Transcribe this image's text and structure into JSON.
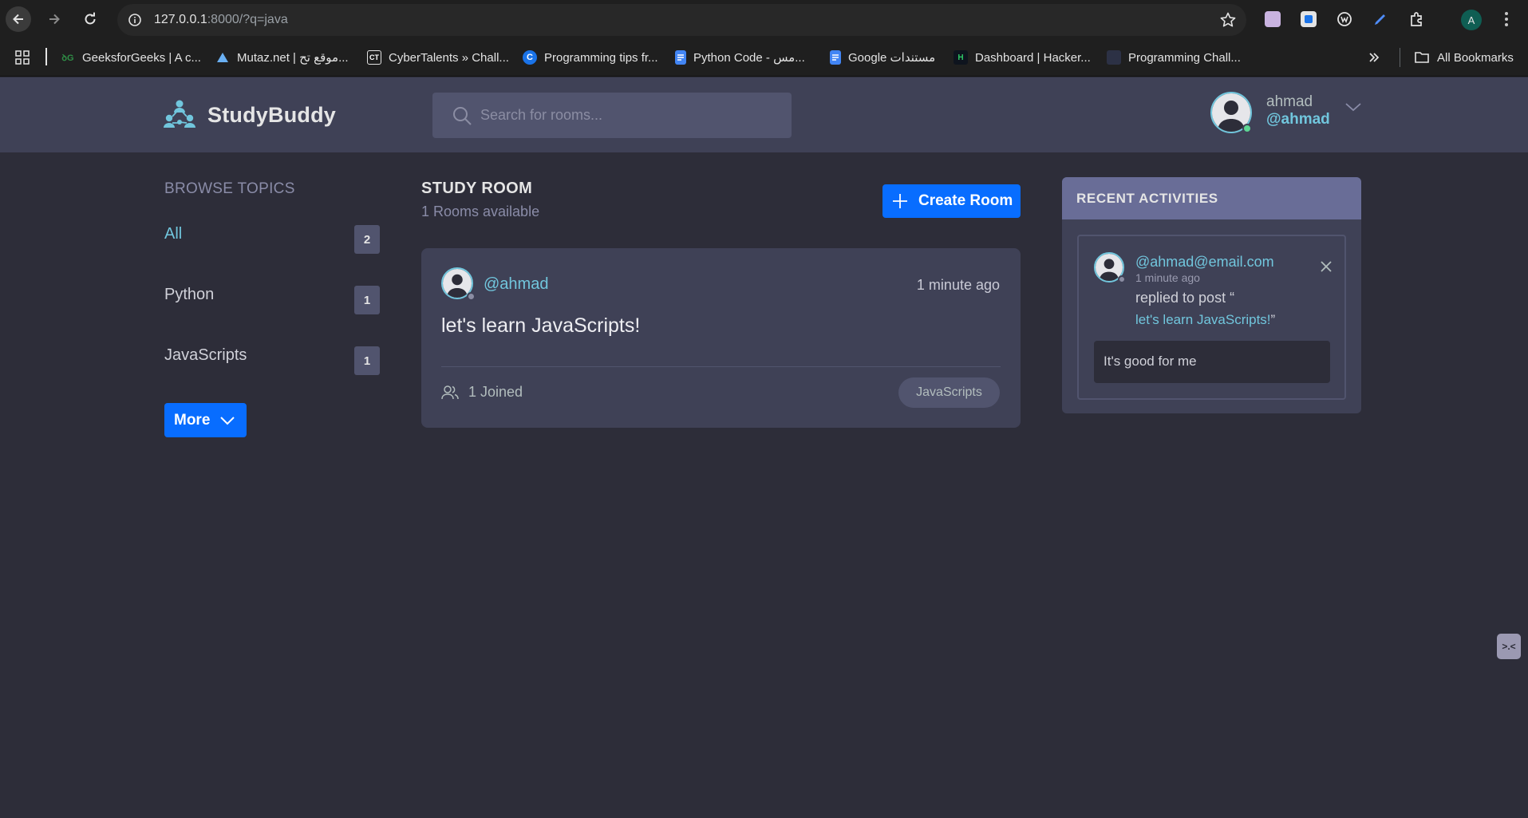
{
  "browser": {
    "url_host": "127.0.0.1",
    "url_path": ":8000/?q=java",
    "bookmarks": [
      {
        "label": "GeeksforGeeks | A c...",
        "icon": "geeksforgeeks-icon",
        "color": "#2f8d46"
      },
      {
        "label": "Mutaz.net | موقع تح...",
        "icon": "mutaz-icon",
        "color": "#4a90d9"
      },
      {
        "label": "CyberTalents » Chall...",
        "icon": "cybertalents-icon",
        "color": "#1e3a8a"
      },
      {
        "label": "Programming tips fr...",
        "icon": "c-logo-icon",
        "color": "#1a73e8"
      },
      {
        "label": "Python Code - مس...",
        "icon": "docs-icon",
        "color": "#4285f4"
      },
      {
        "label": "Google مستندات",
        "icon": "docs-icon",
        "color": "#4285f4"
      },
      {
        "label": "Dashboard | Hacker...",
        "icon": "hackerrank-icon",
        "color": "#0e141e"
      },
      {
        "label": "Programming Chall...",
        "icon": "blank-page-icon",
        "color": "#2c3145"
      }
    ],
    "all_bookmarks_label": "All Bookmarks",
    "profile_initial": "A"
  },
  "header": {
    "brand": "StudyBuddy",
    "search_placeholder": "Search for rooms...",
    "user": {
      "name": "ahmad",
      "handle": "@ahmad"
    }
  },
  "sidebar": {
    "title": "BROWSE TOPICS",
    "topics": [
      {
        "name": "All",
        "count": "2"
      },
      {
        "name": "Python",
        "count": "1"
      },
      {
        "name": "JavaScripts",
        "count": "1"
      }
    ],
    "more_label": "More"
  },
  "main": {
    "heading": "STUDY ROOM",
    "rooms_available": "1 Rooms available",
    "create_label": "Create Room",
    "rooms": [
      {
        "host": "@ahmad",
        "time": "1 minute ago",
        "title": "let's learn JavaScripts!",
        "joined": "1 Joined",
        "topic": "JavaScripts"
      }
    ]
  },
  "activities": {
    "title": "RECENT ACTIVITIES",
    "items": [
      {
        "user": "@ahmad@email.com",
        "time": "1 minute ago",
        "action": "replied to post “",
        "post": "let's learn JavaScripts!",
        "close_quote": "”",
        "message": "It's good for me"
      }
    ]
  },
  "colors": {
    "background": "#2d2d39",
    "panel": "#3f4156",
    "accent": "#71c6dd",
    "primary": "#086dff",
    "online": "#5dd693"
  }
}
